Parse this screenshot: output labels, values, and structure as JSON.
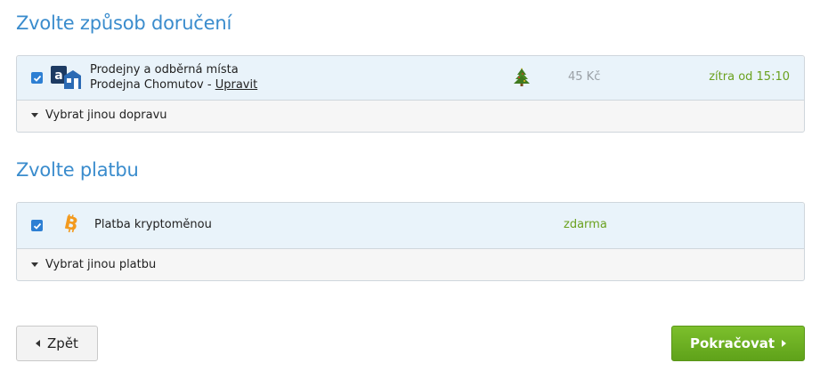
{
  "delivery": {
    "title": "Zvolte způsob doručení",
    "selected": {
      "checked": true,
      "name": "Prodejny a odběrná místa",
      "store_prefix": "Prodejna Chomutov - ",
      "edit_link": "Upravit",
      "price": "45 Kč",
      "availability": "zítra od 15:10",
      "icon": "shop-icon",
      "badge_icon": "christmas-tree-icon"
    },
    "other_link": "Vybrat jinou dopravu"
  },
  "payment": {
    "title": "Zvolte platbu",
    "selected": {
      "checked": true,
      "name": "Platba kryptoměnou",
      "price": "zdarma",
      "icon": "bitcoin-icon"
    },
    "other_link": "Vybrat jinou platbu"
  },
  "actions": {
    "back_label": "Zpět",
    "continue_label": "Pokračovat"
  },
  "colors": {
    "accent_blue": "#3a8ccd",
    "checkbox_blue": "#2d7fd3",
    "green": "#6aa11e",
    "button_green": "#6db322"
  }
}
